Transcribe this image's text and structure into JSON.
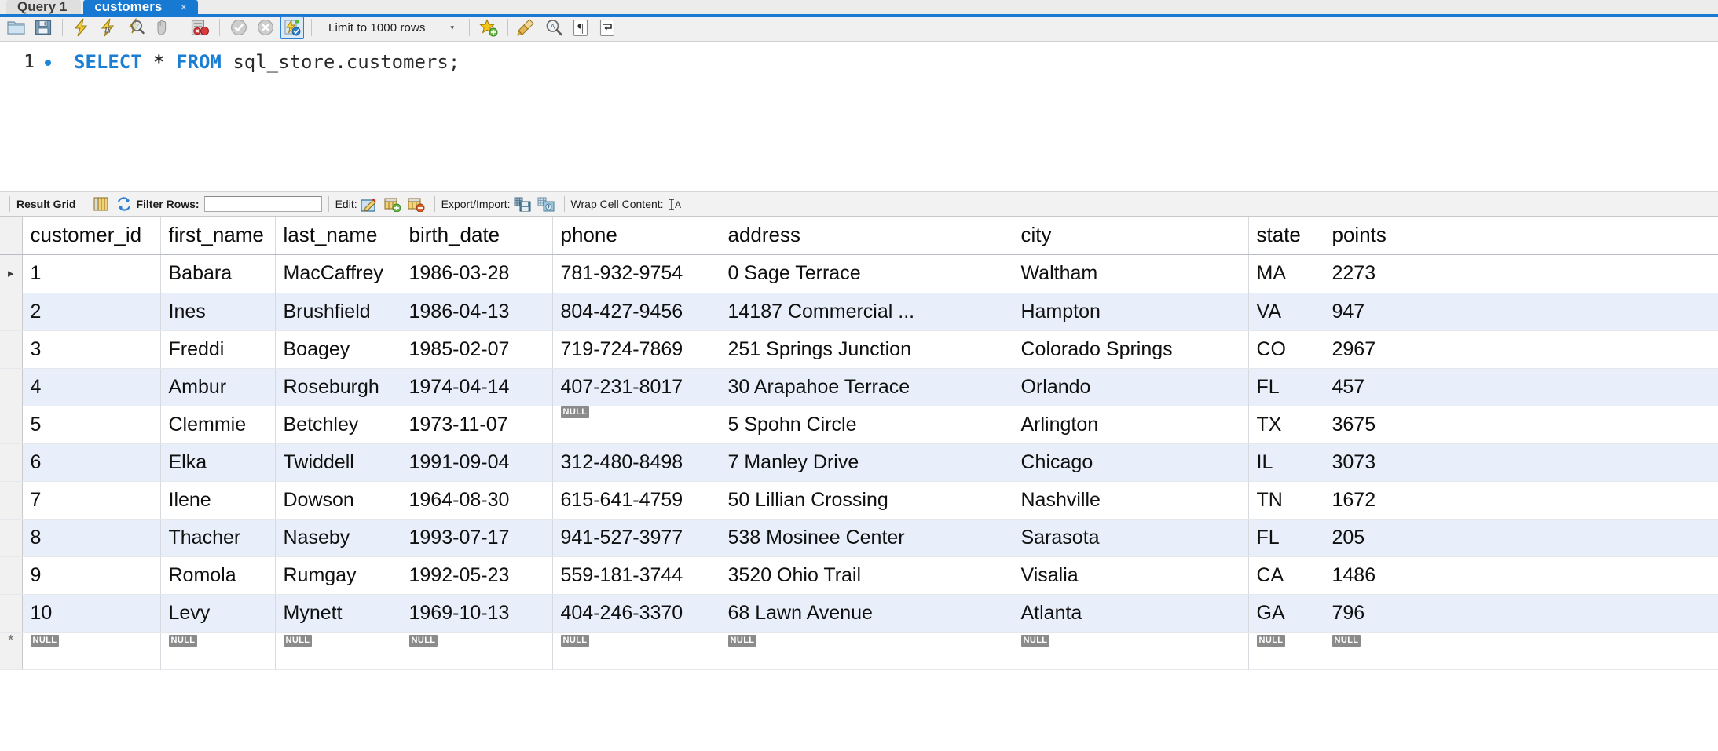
{
  "tabs": [
    {
      "label": "Query 1",
      "active": false,
      "closable": false
    },
    {
      "label": "customers",
      "active": true,
      "closable": true,
      "close_glyph": "×"
    }
  ],
  "toolbar": {
    "icons": [
      {
        "name": "open-script-icon",
        "title": "Open a SQL script file in a new tab"
      },
      {
        "name": "save-script-icon",
        "title": "Save the script to a file"
      },
      {
        "name": "execute-statement-icon",
        "title": "Execute the selected portion or everything"
      },
      {
        "name": "execute-current-statement-icon",
        "title": "Execute the statement under the keyboard cursor"
      },
      {
        "name": "explain-query-icon",
        "title": "Execute Explain for the statement under the cursor"
      },
      {
        "name": "stop-execution-icon",
        "title": "Stop the query being executed"
      },
      {
        "name": "toggle-stop-on-error-icon",
        "title": "Toggle whether execution should stop on errors"
      },
      {
        "name": "commit-icon",
        "title": "Commit the current transaction"
      },
      {
        "name": "rollback-icon",
        "title": "Rollback the current transaction"
      },
      {
        "name": "toggle-autocommit-icon",
        "title": "Toggle autocommit mode",
        "selected": true
      }
    ],
    "limit_dropdown": {
      "label": "Limit to 1000 rows",
      "arrow": "▾"
    },
    "right_icons": [
      {
        "name": "save-snippet-icon",
        "title": "Save current statement to snippets list"
      },
      {
        "name": "beautify-query-icon",
        "title": "Beautify/reformat the SQL script"
      },
      {
        "name": "find-icon",
        "title": "Show the Find panel"
      },
      {
        "name": "toggle-invisible-chars-icon",
        "title": "Toggle invisible characters"
      },
      {
        "name": "toggle-word-wrap-icon",
        "title": "Toggle wrapping of long lines"
      }
    ]
  },
  "editor": {
    "line_number": "1",
    "has_statement_marker": true,
    "statement": {
      "keyword1": "SELECT",
      "star": "*",
      "keyword2": "FROM",
      "object": "sql_store.customers;"
    }
  },
  "result_toolbar": {
    "result_grid_label": "Result Grid",
    "grid_view_icon": "grid-view-icon",
    "refresh_icon": "refresh-icon",
    "filter_rows_label": "Filter Rows:",
    "filter_value": "",
    "filter_placeholder": "",
    "edit_label": "Edit:",
    "edit_icons": [
      "edit-cell-icon",
      "insert-row-icon",
      "delete-row-icon"
    ],
    "export_import_label": "Export/Import:",
    "export_import_icons": [
      "export-recordset-icon",
      "import-recordset-icon"
    ],
    "wrap_cell_label": "Wrap Cell Content:",
    "wrap_cell_icon": "wrap-cell-icon"
  },
  "result_grid": {
    "columns": [
      "customer_id",
      "first_name",
      "last_name",
      "birth_date",
      "phone",
      "address",
      "city",
      "state",
      "points"
    ],
    "selected_row_index": 0,
    "rows": [
      {
        "customer_id": "1",
        "first_name": "Babara",
        "last_name": "MacCaffrey",
        "birth_date": "1986-03-28",
        "phone": "781-932-9754",
        "address": "0 Sage Terrace",
        "city": "Waltham",
        "state": "MA",
        "points": "2273"
      },
      {
        "customer_id": "2",
        "first_name": "Ines",
        "last_name": "Brushfield",
        "birth_date": "1986-04-13",
        "phone": "804-427-9456",
        "address": "14187 Commercial ...",
        "city": "Hampton",
        "state": "VA",
        "points": "947"
      },
      {
        "customer_id": "3",
        "first_name": "Freddi",
        "last_name": "Boagey",
        "birth_date": "1985-02-07",
        "phone": "719-724-7869",
        "address": "251 Springs Junction",
        "city": "Colorado Springs",
        "state": "CO",
        "points": "2967"
      },
      {
        "customer_id": "4",
        "first_name": "Ambur",
        "last_name": "Roseburgh",
        "birth_date": "1974-04-14",
        "phone": "407-231-8017",
        "address": "30 Arapahoe Terrace",
        "city": "Orlando",
        "state": "FL",
        "points": "457"
      },
      {
        "customer_id": "5",
        "first_name": "Clemmie",
        "last_name": "Betchley",
        "birth_date": "1973-11-07",
        "phone": null,
        "address": "5 Spohn Circle",
        "city": "Arlington",
        "state": "TX",
        "points": "3675"
      },
      {
        "customer_id": "6",
        "first_name": "Elka",
        "last_name": "Twiddell",
        "birth_date": "1991-09-04",
        "phone": "312-480-8498",
        "address": "7 Manley Drive",
        "city": "Chicago",
        "state": "IL",
        "points": "3073"
      },
      {
        "customer_id": "7",
        "first_name": "Ilene",
        "last_name": "Dowson",
        "birth_date": "1964-08-30",
        "phone": "615-641-4759",
        "address": "50 Lillian Crossing",
        "city": "Nashville",
        "state": "TN",
        "points": "1672"
      },
      {
        "customer_id": "8",
        "first_name": "Thacher",
        "last_name": "Naseby",
        "birth_date": "1993-07-17",
        "phone": "941-527-3977",
        "address": "538 Mosinee Center",
        "city": "Sarasota",
        "state": "FL",
        "points": "205"
      },
      {
        "customer_id": "9",
        "first_name": "Romola",
        "last_name": "Rumgay",
        "birth_date": "1992-05-23",
        "phone": "559-181-3744",
        "address": "3520 Ohio Trail",
        "city": "Visalia",
        "state": "CA",
        "points": "1486"
      },
      {
        "customer_id": "10",
        "first_name": "Levy",
        "last_name": "Mynett",
        "birth_date": "1969-10-13",
        "phone": "404-246-3370",
        "address": "68 Lawn Avenue",
        "city": "Atlanta",
        "state": "GA",
        "points": "796"
      }
    ],
    "new_row": {
      "marker": "*",
      "null_label": "NULL",
      "cells": [
        "NULL",
        "NULL",
        "NULL",
        "NULL",
        "NULL",
        "NULL",
        "NULL",
        "NULL",
        "NULL"
      ]
    },
    "null_label": "NULL",
    "row_marker_glyph": "▸"
  },
  "colors": {
    "accent": "#1879d2",
    "keyword": "#1a7fd4",
    "alt_row": "#e9effa",
    "null_badge": "#8b8b8b",
    "toolbar_bg": "#f0f0f0"
  }
}
